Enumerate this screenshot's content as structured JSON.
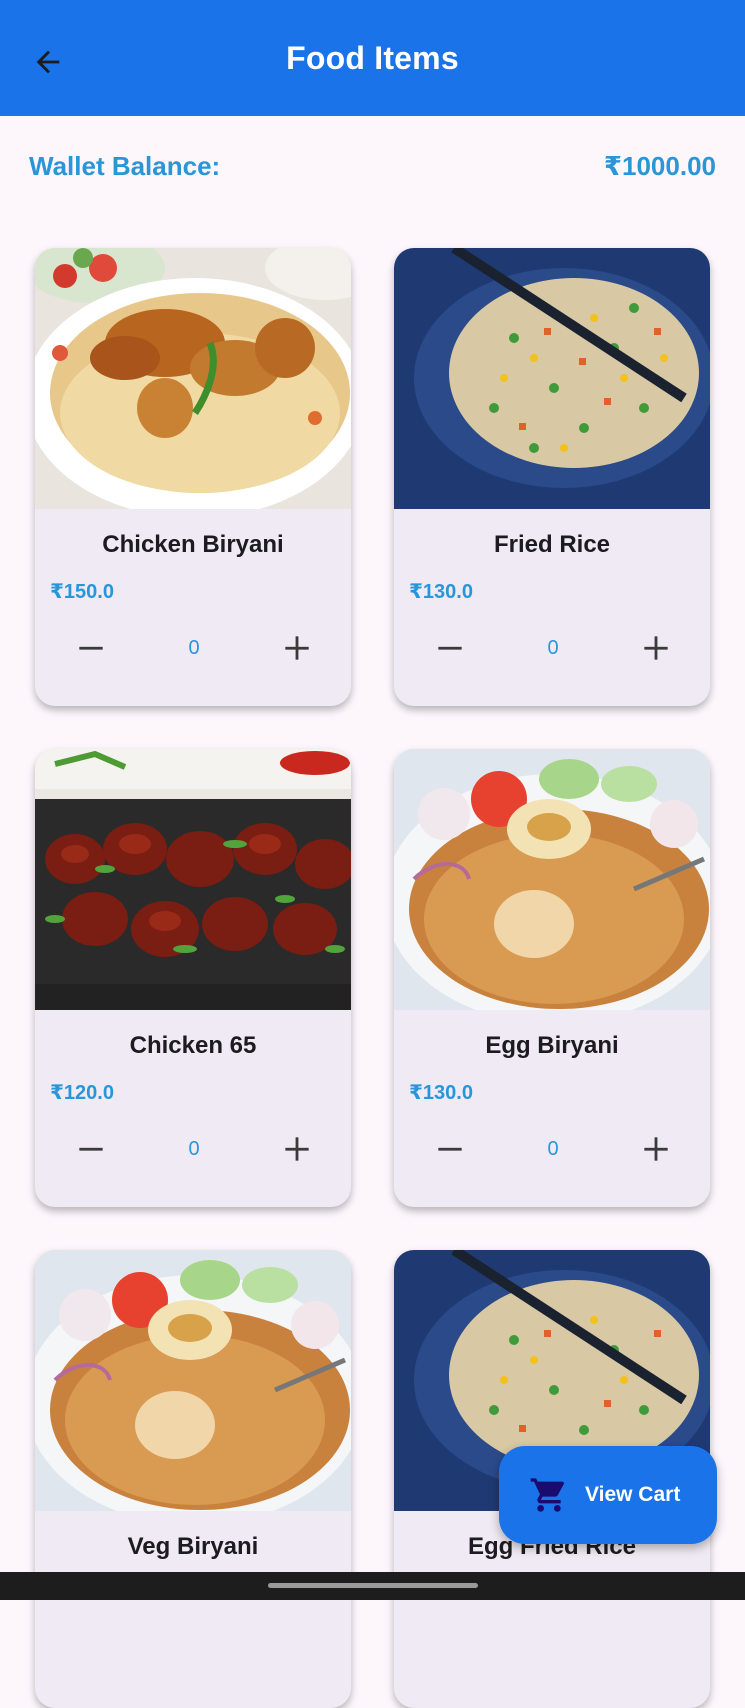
{
  "appbar": {
    "title": "Food Items"
  },
  "wallet": {
    "label": "Wallet Balance:",
    "amount": "₹1000.00"
  },
  "items": [
    {
      "name": "Chicken Biryani",
      "price": "₹150.0",
      "qty": "0"
    },
    {
      "name": "Fried Rice",
      "price": "₹130.0",
      "qty": "0"
    },
    {
      "name": "Chicken 65",
      "price": "₹120.0",
      "qty": "0"
    },
    {
      "name": "Egg Biryani",
      "price": "₹130.0",
      "qty": "0"
    },
    {
      "name": "Veg Biryani"
    },
    {
      "name": "Egg Fried Rice"
    }
  ],
  "fab": {
    "label": "View Cart"
  },
  "colors": {
    "primary": "#1a73e8",
    "accent": "#2996d8",
    "card": "#efeaf3"
  }
}
